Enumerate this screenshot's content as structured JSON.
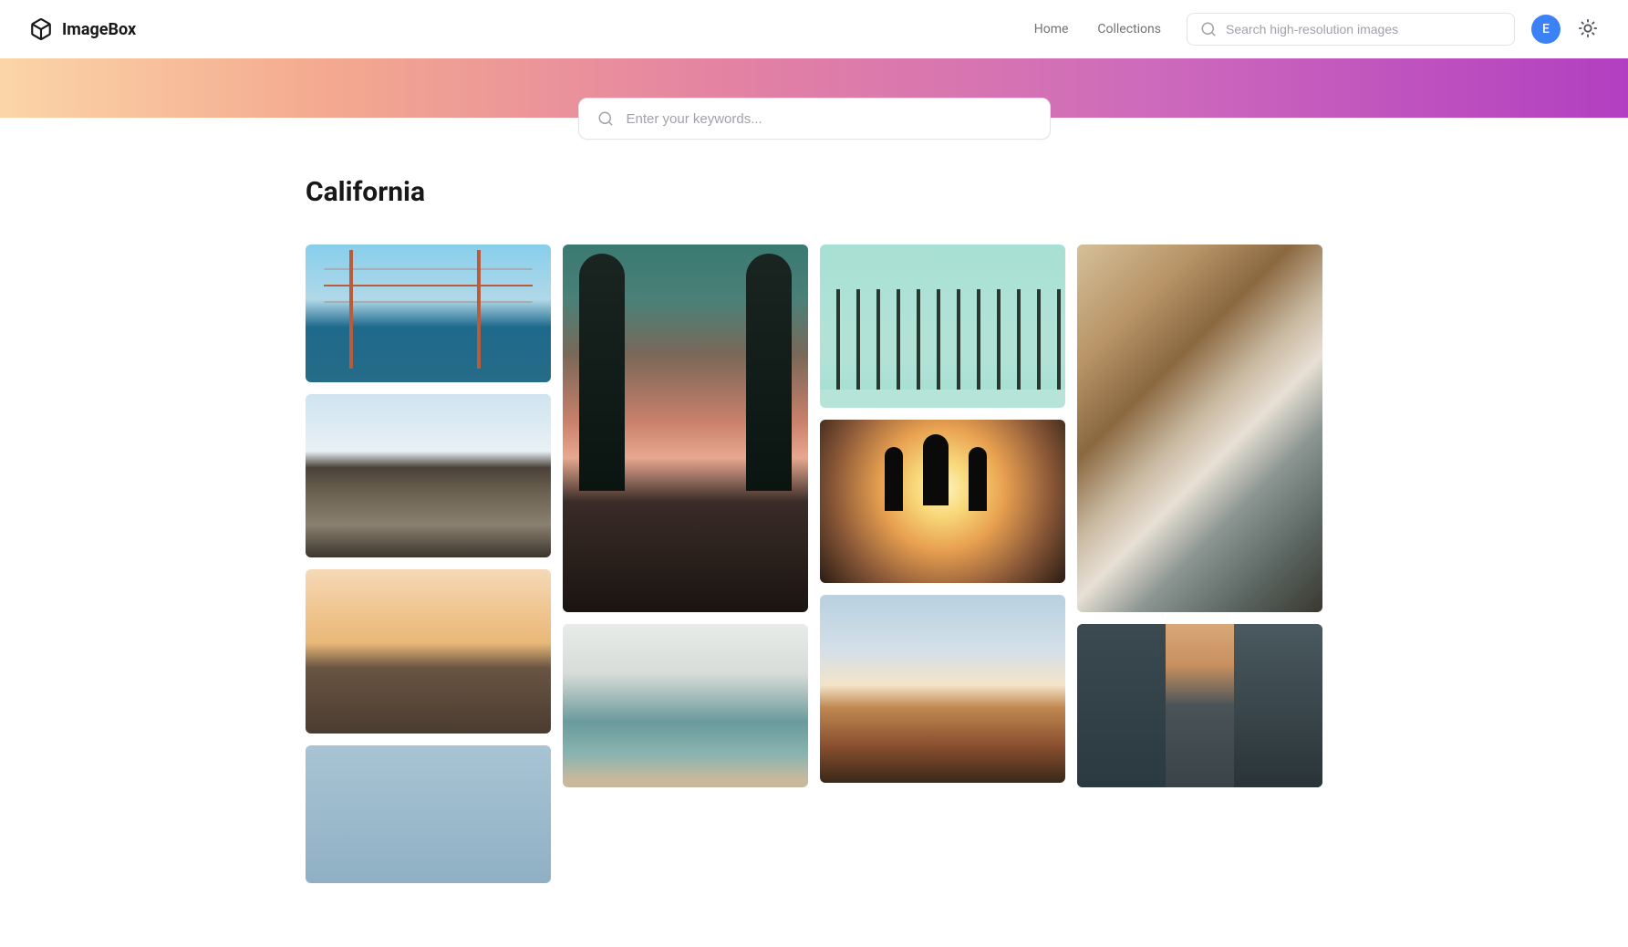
{
  "brand": {
    "name": "ImageBox"
  },
  "nav": {
    "home": "Home",
    "collections": "Collections"
  },
  "header_search": {
    "placeholder": "Search high-resolution images"
  },
  "avatar": {
    "initial": "E"
  },
  "hero_search": {
    "placeholder": "Enter your keywords..."
  },
  "page": {
    "title": "California"
  }
}
